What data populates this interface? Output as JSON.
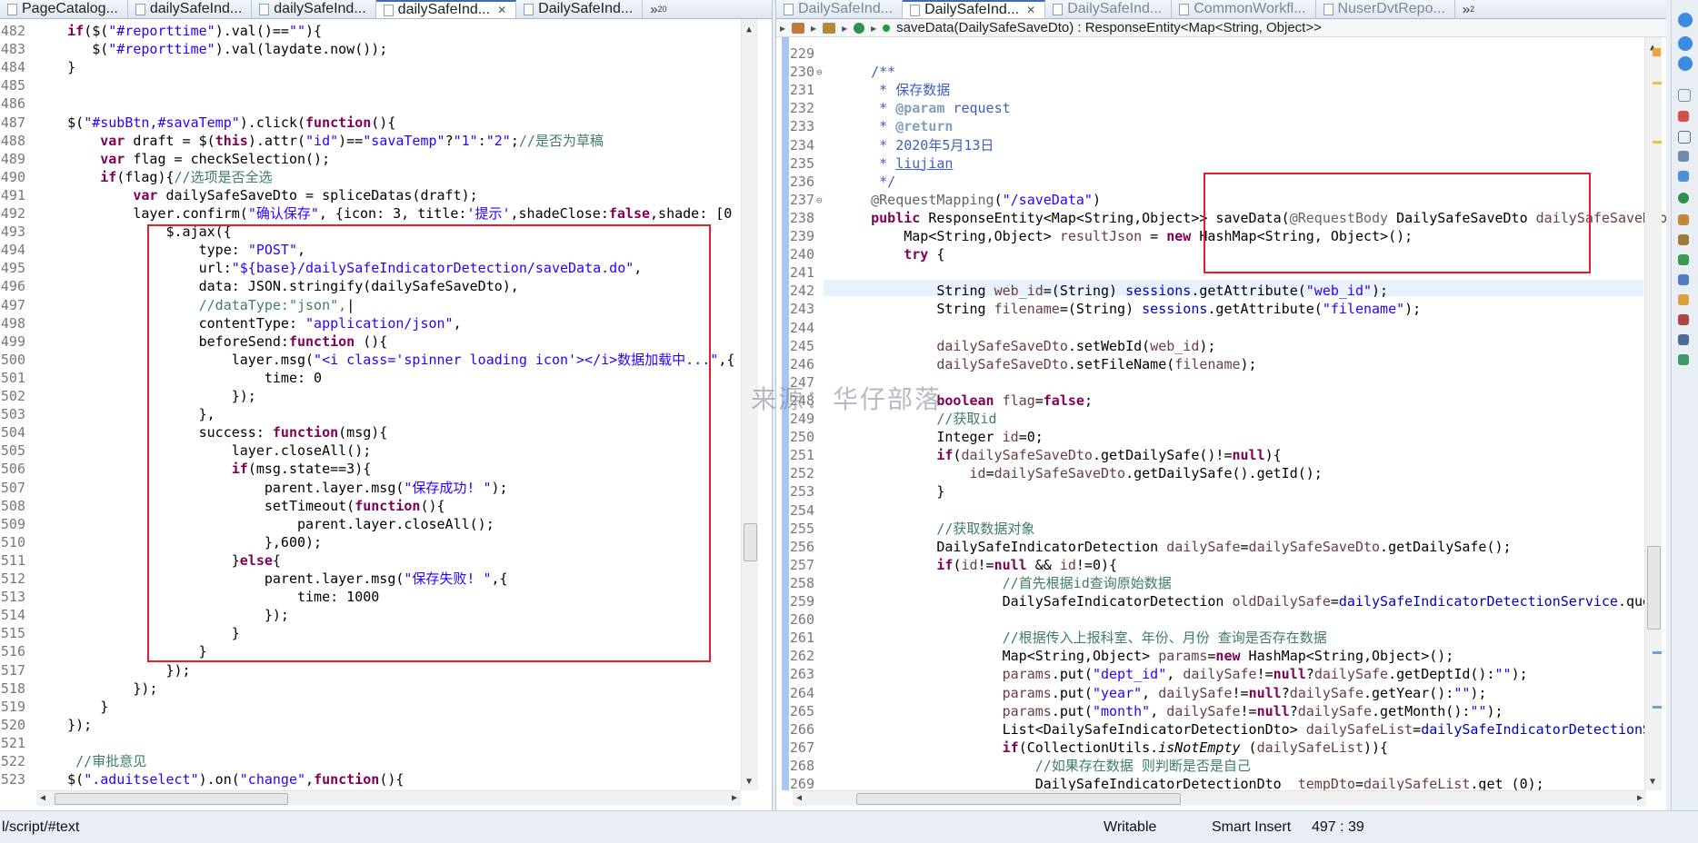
{
  "left_editor": {
    "tabs": [
      {
        "label": "PageCatalog...",
        "active": false,
        "closable": false
      },
      {
        "label": "dailySafeInd...",
        "active": false,
        "closable": false
      },
      {
        "label": "dailySafeInd...",
        "active": false,
        "closable": false
      },
      {
        "label": "dailySafeInd...",
        "active": true,
        "closable": true
      },
      {
        "label": "DailySafeInd...",
        "active": false,
        "closable": false
      }
    ],
    "overflow_label": "»",
    "overflow_count": "20",
    "lines": [
      {
        "n": "482",
        "html": "    <span class=\"kw\">if</span>($(<span class=\"str\">\"#reporttime\"</span>).val()==<span class=\"str\">\"\"</span>){"
      },
      {
        "n": "483",
        "html": "       $(<span class=\"str\">\"#reporttime\"</span>).val(laydate.now());"
      },
      {
        "n": "484",
        "html": "    }"
      },
      {
        "n": "485",
        "html": ""
      },
      {
        "n": "486",
        "html": ""
      },
      {
        "n": "487",
        "html": "    $(<span class=\"str\">\"#subBtn,#savaTemp\"</span>).click(<span class=\"kw\">function</span>(){"
      },
      {
        "n": "488",
        "html": "        <span class=\"kw\">var</span> draft = $(<span class=\"kw\">this</span>).attr(<span class=\"str\">\"id\"</span>)==<span class=\"str\">\"savaTemp\"</span>?<span class=\"str\">\"1\"</span>:<span class=\"str\">\"2\"</span>;<span class=\"cm\">//是否为草稿</span>"
      },
      {
        "n": "489",
        "html": "        <span class=\"kw\">var</span> flag = checkSelection();"
      },
      {
        "n": "490",
        "html": "        <span class=\"kw\">if</span>(flag){<span class=\"cm\">//选项是否全选</span>"
      },
      {
        "n": "491",
        "html": "            <span class=\"kw\">var</span> dailySafeSaveDto = spliceDatas(draft);"
      },
      {
        "n": "492",
        "html": "            layer.confirm(<span class=\"str\">\"确认保存\"</span>, {icon: 3, title:<span class=\"str\">'提示'</span>,shadeClose:<span class=\"kw\">false</span>,shade: [0"
      },
      {
        "n": "493",
        "html": "                $.ajax({"
      },
      {
        "n": "494",
        "html": "                    type: <span class=\"str\">\"POST\"</span>,"
      },
      {
        "n": "495",
        "html": "                    url:<span class=\"str\">\"${base}/dailySafeIndicatorDetection/saveData.do\"</span>,"
      },
      {
        "n": "496",
        "html": "                    data: JSON.stringify(dailySafeSaveDto),"
      },
      {
        "n": "497",
        "html": "                    <span class=\"cm\">//dataType:\"json\",</span>|"
      },
      {
        "n": "498",
        "html": "                    contentType: <span class=\"str\">\"application/json\"</span>,"
      },
      {
        "n": "499",
        "html": "                    beforeSend:<span class=\"kw\">function</span> (){"
      },
      {
        "n": "500",
        "html": "                        layer.msg(<span class=\"str\">\"&lt;i class='spinner loading icon'&gt;&lt;/i&gt;数据加载中...\"</span>,{"
      },
      {
        "n": "501",
        "html": "                            time: 0"
      },
      {
        "n": "502",
        "html": "                        });"
      },
      {
        "n": "503",
        "html": "                    },"
      },
      {
        "n": "504",
        "html": "                    success: <span class=\"kw\">function</span>(msg){"
      },
      {
        "n": "505",
        "html": "                        layer.closeAll();"
      },
      {
        "n": "506",
        "html": "                        <span class=\"kw\">if</span>(msg.state==3){"
      },
      {
        "n": "507",
        "html": "                            parent.layer.msg(<span class=\"str\">\"保存成功! \"</span>);"
      },
      {
        "n": "508",
        "html": "                            setTimeout(<span class=\"kw\">function</span>(){"
      },
      {
        "n": "509",
        "html": "                                parent.layer.closeAll();"
      },
      {
        "n": "510",
        "html": "                            },600);"
      },
      {
        "n": "511",
        "html": "                        }<span class=\"kw\">else</span>{"
      },
      {
        "n": "512",
        "html": "                            parent.layer.msg(<span class=\"str\">\"保存失败! \"</span>,{"
      },
      {
        "n": "513",
        "html": "                                time: 1000"
      },
      {
        "n": "514",
        "html": "                            });"
      },
      {
        "n": "515",
        "html": "                        }"
      },
      {
        "n": "516",
        "html": "                    }"
      },
      {
        "n": "517",
        "html": "                });"
      },
      {
        "n": "518",
        "html": "            });"
      },
      {
        "n": "519",
        "html": "        }"
      },
      {
        "n": "520",
        "html": "    });"
      },
      {
        "n": "521",
        "html": ""
      },
      {
        "n": "522",
        "html": "     <span class=\"cm\">//审批意见</span>"
      },
      {
        "n": "523",
        "html": "    $(<span class=\"str\">\".aduitselect\"</span>).on(<span class=\"str\">\"change\"</span>,<span class=\"kw\">function</span>(){"
      }
    ]
  },
  "right_editor": {
    "tabs": [
      {
        "label": "DailySafeInd...",
        "active": false,
        "dim": true,
        "closable": false
      },
      {
        "label": "DailySafeInd...",
        "active": true,
        "dim": false,
        "closable": true
      },
      {
        "label": "DailySafeInd...",
        "active": false,
        "dim": true,
        "closable": false
      },
      {
        "label": "CommonWorkfl...",
        "active": false,
        "dim": true,
        "closable": false
      },
      {
        "label": "NuserDvtRepo...",
        "active": false,
        "dim": true,
        "closable": false
      }
    ],
    "overflow_label": "»",
    "overflow_count": "2",
    "breadcrumb_method": "saveData(DailySafeSaveDto) : ResponseEntity<Map<String, Object>>",
    "lines": [
      {
        "n": "229",
        "html": ""
      },
      {
        "n": "230",
        "fold": "⊖",
        "html": "    <span class=\"jd\">/**</span>"
      },
      {
        "n": "231",
        "html": "     <span class=\"jd\">* 保存数据</span>"
      },
      {
        "n": "232",
        "html": "     <span class=\"jd\">* <span style=\"color:#7f9fbf;font-weight:bold\">@param</span> request</span>"
      },
      {
        "n": "233",
        "html": "     <span class=\"jd\">* <span style=\"color:#7f9fbf;font-weight:bold\">@return</span></span>"
      },
      {
        "n": "234",
        "html": "     <span class=\"jd\">* 2020年5月13日</span>"
      },
      {
        "n": "235",
        "html": "     <span class=\"jd\">* <u>liujian</u></span>"
      },
      {
        "n": "236",
        "html": "     <span class=\"jd\">*/</span>"
      },
      {
        "n": "237",
        "fold": "⊖",
        "html": "    <span class=\"ann\">@RequestMapping</span>(<span class=\"str\">\"/saveData\"</span>)"
      },
      {
        "n": "238",
        "html": "    <span class=\"kw\">public</span> ResponseEntity&lt;Map&lt;String,Object&gt;&gt; saveData(<span class=\"ann\">@RequestBody</span> DailySafeSaveDto <span class=\"var\">dailySafeSaveDto</span>){"
      },
      {
        "n": "239",
        "html": "        Map&lt;String,Object&gt; <span class=\"var\">resultJson</span> = <span class=\"kw\">new</span> HashMap&lt;String, Object&gt;();"
      },
      {
        "n": "240",
        "html": "        <span class=\"kw\">try</span> {"
      },
      {
        "n": "241",
        "html": ""
      },
      {
        "n": "242",
        "html": "            String <span class=\"var\">web_id</span>=(String) <span class=\"fld\">sessions</span>.getAttribute(<span class=\"str\">\"web_id\"</span>);"
      },
      {
        "n": "243",
        "html": "            String <span class=\"var\">filename</span>=(String) <span class=\"fld\">sessions</span>.getAttribute(<span class=\"str\">\"filename\"</span>);"
      },
      {
        "n": "244",
        "html": ""
      },
      {
        "n": "245",
        "html": "            <span class=\"var\">dailySafeSaveDto</span>.setWebId(<span class=\"var\">web_id</span>);"
      },
      {
        "n": "246",
        "html": "            <span class=\"var\">dailySafeSaveDto</span>.setFileName(<span class=\"var\">filename</span>);"
      },
      {
        "n": "247",
        "html": ""
      },
      {
        "n": "248",
        "html": "            <span class=\"kw\">boolean</span> <span class=\"var\">flag</span>=<span class=\"kw\">false</span>;"
      },
      {
        "n": "249",
        "html": "            <span class=\"cm\">//获取id</span>"
      },
      {
        "n": "250",
        "html": "            Integer <span class=\"var\">id</span>=0;"
      },
      {
        "n": "251",
        "html": "            <span class=\"kw\">if</span>(<span class=\"var\">dailySafeSaveDto</span>.getDailySafe()!=<span class=\"kw\">null</span>){"
      },
      {
        "n": "252",
        "html": "                <span class=\"var\">id</span>=<span class=\"var\">dailySafeSaveDto</span>.getDailySafe().getId();"
      },
      {
        "n": "253",
        "html": "            }"
      },
      {
        "n": "254",
        "html": ""
      },
      {
        "n": "255",
        "html": "            <span class=\"cm\">//获取数据对象</span>"
      },
      {
        "n": "256",
        "html": "            DailySafeIndicatorDetection <span class=\"var\">dailySafe</span>=<span class=\"var\">dailySafeSaveDto</span>.getDailySafe();"
      },
      {
        "n": "257",
        "html": "            <span class=\"kw\">if</span>(<span class=\"var\">id</span>!=<span class=\"kw\">null</span> &amp;&amp; <span class=\"var\">id</span>!=0){"
      },
      {
        "n": "258",
        "html": "                    <span class=\"cm\">//首先根据id查询原始数据</span>"
      },
      {
        "n": "259",
        "html": "                    DailySafeIndicatorDetection <span class=\"var\">oldDailySafe</span>=<span class=\"fld\">dailySafeIndicatorDetectionService</span>.que"
      },
      {
        "n": "260",
        "html": ""
      },
      {
        "n": "261",
        "html": "                    <span class=\"cm\">//根据传入上报科室、年份、月份 查询是否存在数据</span>"
      },
      {
        "n": "262",
        "html": "                    Map&lt;String,Object&gt; <span class=\"var\">params</span>=<span class=\"kw\">new</span> HashMap&lt;String,Object&gt;();"
      },
      {
        "n": "263",
        "html": "                    <span class=\"var\">params</span>.put(<span class=\"str\">\"dept_id\"</span>, <span class=\"var\">dailySafe</span>!=<span class=\"kw\">null</span>?<span class=\"var\">dailySafe</span>.getDeptId():<span class=\"str\">\"\"</span>);"
      },
      {
        "n": "264",
        "html": "                    <span class=\"var\">params</span>.put(<span class=\"str\">\"year\"</span>, <span class=\"var\">dailySafe</span>!=<span class=\"kw\">null</span>?<span class=\"var\">dailySafe</span>.getYear():<span class=\"str\">\"\"</span>);"
      },
      {
        "n": "265",
        "html": "                    <span class=\"var\">params</span>.put(<span class=\"str\">\"month\"</span>, <span class=\"var\">dailySafe</span>!=<span class=\"kw\">null</span>?<span class=\"var\">dailySafe</span>.getMonth():<span class=\"str\">\"\"</span>);"
      },
      {
        "n": "266",
        "html": "                    List&lt;DailySafeIndicatorDetectionDto&gt; <span class=\"var\">dailySafeList</span>=<span class=\"fld\">dailySafeIndicatorDetection</span>S"
      },
      {
        "n": "267",
        "html": "                    <span class=\"kw\">if</span>(CollectionUtils.<i>isNotEmpty</i> (<span class=\"var\">dailySafeList</span>)){"
      },
      {
        "n": "268",
        "html": "                        <span class=\"cm\">//如果存在数据 则判断是否是自己</span>"
      },
      {
        "n": "269",
        "html": "                        DailySafeIndicatorDetectionDto  <span class=\"var\">tempDto</span>=<span class=\"var\">dailySafeList</span>.get (0);"
      }
    ]
  },
  "status": {
    "path": "l/script/#text",
    "mode": "Writable",
    "insert": "Smart Insert",
    "position": "497 : 39"
  },
  "watermark": "来源：华仔部落"
}
